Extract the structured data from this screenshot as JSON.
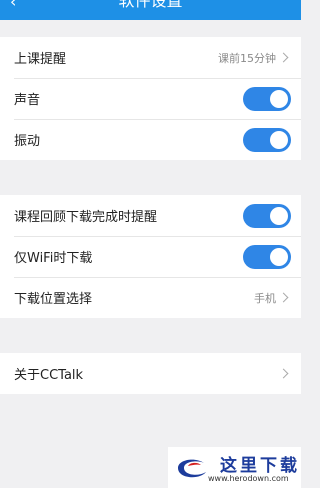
{
  "header": {
    "title": "软件设置"
  },
  "group1": {
    "reminder": {
      "label": "上课提醒",
      "value": "课前15分钟"
    },
    "sound": {
      "label": "声音",
      "on": true
    },
    "vibrate": {
      "label": "振动",
      "on": true
    }
  },
  "group2": {
    "download_notify": {
      "label": "课程回顾下载完成时提醒",
      "on": true
    },
    "wifi_only": {
      "label": "仅WiFi时下载",
      "on": true
    },
    "location": {
      "label": "下载位置选择",
      "value": "手机"
    }
  },
  "group3": {
    "about": {
      "label": "关于CCTalk"
    }
  },
  "watermark": {
    "text": "这里下载",
    "url": "www.herodown.com"
  },
  "colors": {
    "accent": "#2f86e6",
    "header": "#1e90e6",
    "background": "#f0f0f2"
  }
}
